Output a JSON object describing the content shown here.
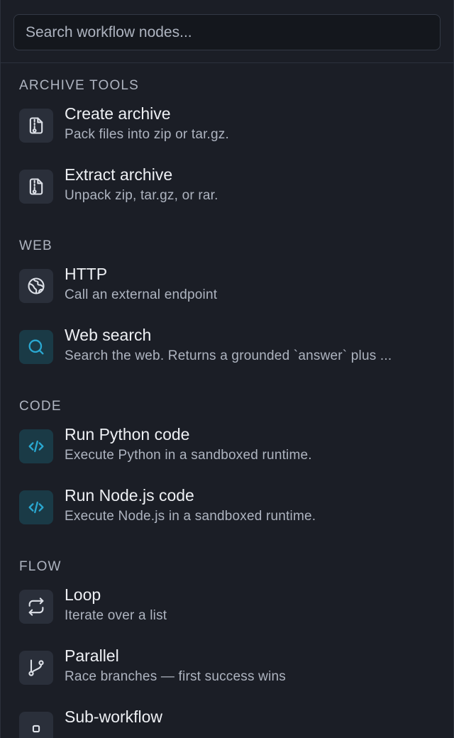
{
  "search": {
    "placeholder": "Search workflow nodes..."
  },
  "colors": {
    "background": "#1b1e26",
    "icon_tile": "#2a2f3a",
    "icon_tile_accent": "#1a3a46",
    "accent": "#2aa8d1",
    "icon_default": "#dde1e8"
  },
  "sections": [
    {
      "title": "ARCHIVE TOOLS",
      "items": [
        {
          "icon": "archive-file-icon",
          "title": "Create archive",
          "desc": "Pack files into zip or tar.gz."
        },
        {
          "icon": "archive-file-icon",
          "title": "Extract archive",
          "desc": "Unpack zip, tar.gz, or rar."
        }
      ]
    },
    {
      "title": "WEB",
      "items": [
        {
          "icon": "globe-icon",
          "title": "HTTP",
          "desc": "Call an external endpoint"
        },
        {
          "icon": "search-icon",
          "title": "Web search",
          "desc": "Search the web. Returns a grounded `answer` plus ..."
        }
      ]
    },
    {
      "title": "CODE",
      "items": [
        {
          "icon": "code-icon",
          "title": "Run Python code",
          "desc": "Execute Python in a sandboxed runtime."
        },
        {
          "icon": "code-icon",
          "title": "Run Node.js code",
          "desc": "Execute Node.js in a sandboxed runtime."
        }
      ]
    },
    {
      "title": "FLOW",
      "items": [
        {
          "icon": "loop-icon",
          "title": "Loop",
          "desc": "Iterate over a list"
        },
        {
          "icon": "branch-icon",
          "title": "Parallel",
          "desc": "Race branches — first success wins"
        },
        {
          "icon": "subworkflow-icon",
          "title": "Sub-workflow",
          "desc": ""
        }
      ]
    }
  ]
}
